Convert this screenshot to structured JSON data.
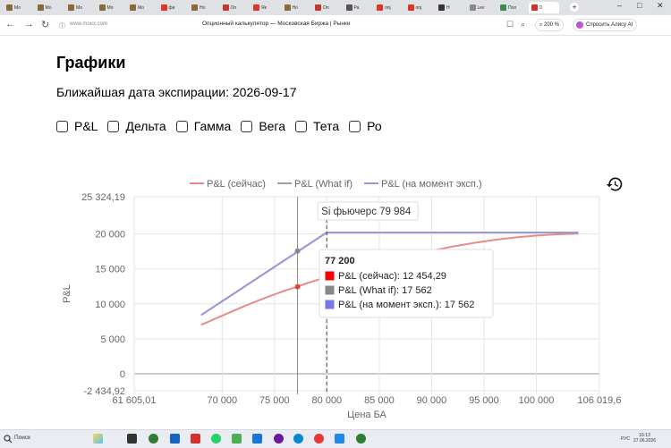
{
  "browser": {
    "tabs": [
      {
        "label": "Мо",
        "color": "#8b6a3a"
      },
      {
        "label": "Мо",
        "color": "#8b6a3a"
      },
      {
        "label": "Мо",
        "color": "#8b6a3a"
      },
      {
        "label": "Мо",
        "color": "#8b6a3a"
      },
      {
        "label": "Мо",
        "color": "#8b6a3a"
      },
      {
        "label": "фи",
        "color": "#e0352b"
      },
      {
        "label": "Но",
        "color": "#8b6a3a"
      },
      {
        "label": "Оп",
        "color": "#c0392b"
      },
      {
        "label": "Як",
        "color": "#e0352b"
      },
      {
        "label": "Но",
        "color": "#8b6a3a"
      },
      {
        "label": "Оп",
        "color": "#c0392b"
      },
      {
        "label": "Ра",
        "color": "#555"
      },
      {
        "label": "onj",
        "color": "#e0352b"
      },
      {
        "label": "onj",
        "color": "#e0352b"
      },
      {
        "label": "Н",
        "color": "#333"
      },
      {
        "label": "Lev",
        "color": "#888"
      },
      {
        "label": "Пол",
        "color": "#3a8c4f"
      },
      {
        "label": "О",
        "color": "#d32f2f",
        "active": true
      }
    ],
    "new_tab": "+",
    "url_domain": "www.moex.com",
    "page_title": "Опционный калькулятор — Московская Биржа | Рынки",
    "zoom": "200 %",
    "alice": "Спросить Алису AI"
  },
  "page": {
    "title": "Графики",
    "expiry_text": "Ближайшая дата экспирации: 2026-09-17",
    "checkboxes": [
      "P&L",
      "Дельта",
      "Гамма",
      "Вега",
      "Тета",
      "Ро"
    ]
  },
  "chart_data": {
    "type": "line",
    "legend": [
      "P&L (сейчас)",
      "P&L (What if)",
      "P&L (на момент эксп.)"
    ],
    "legend_position": "top",
    "xlabel": "Цена БА",
    "ylabel": "P&L",
    "xlim": [
      61605.01,
      106019.6
    ],
    "ylim": [
      -2434.92,
      25324.19
    ],
    "x_ticks": [
      "61 605,01",
      "70 000",
      "75 000",
      "80 000",
      "85 000",
      "90 000",
      "95 000",
      "100 000",
      "106 019,6"
    ],
    "y_ticks": [
      "25 324,19",
      "20 000",
      "15 000",
      "10 000",
      "5 000",
      "0",
      "-2 434,92"
    ],
    "x_tick_values": [
      61605.01,
      70000,
      75000,
      80000,
      85000,
      90000,
      95000,
      100000,
      106019.6
    ],
    "y_tick_values": [
      25324.19,
      20000,
      15000,
      10000,
      5000,
      0,
      -2434.92
    ],
    "series": [
      {
        "name": "P&L (сейчас)",
        "color": "#e88a8a",
        "x": [
          68000,
          70000,
          72000,
          74000,
          76000,
          77200,
          78000,
          80000,
          82000,
          84000,
          86000,
          88000,
          90000,
          92000,
          94000,
          96000,
          98000,
          100000,
          102000,
          104000
        ],
        "y": [
          7000,
          8300,
          9600,
          10800,
          11900,
          12454.29,
          12900,
          13850,
          14700,
          15500,
          16250,
          16950,
          17600,
          18200,
          18700,
          19150,
          19500,
          19780,
          19950,
          20050
        ]
      },
      {
        "name": "P&L (What if)",
        "color": "#a0a0a0",
        "x": [
          68000,
          79984,
          104000
        ],
        "y": [
          8400,
          20200,
          20200
        ]
      },
      {
        "name": "P&L (на момент эксп.)",
        "color": "#9999dd",
        "x": [
          68000,
          79984,
          104000
        ],
        "y": [
          8400,
          20200,
          20200
        ]
      }
    ],
    "hover": {
      "x": 77200,
      "title": "77 200",
      "items": [
        {
          "label": "P&L (сейчас): 12 454,29",
          "color": "#ff0000"
        },
        {
          "label": "P&L (What if): 17 562",
          "color": "#888888"
        },
        {
          "label": "P&L (на момент эксп.): 17 562",
          "color": "#7777ee"
        }
      ],
      "what_if_y": 17562
    },
    "annotation": {
      "x": 79984,
      "label": "Si фьючерс 79 984"
    }
  },
  "taskbar": {
    "search": "Поиск",
    "lang": "РУС",
    "time": "16:13",
    "date": "27.06.2026"
  }
}
